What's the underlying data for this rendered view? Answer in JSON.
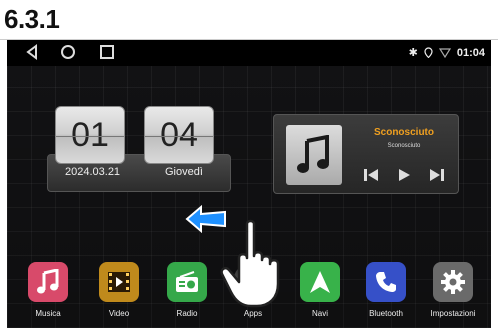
{
  "doc_label": "6.3.1",
  "status": {
    "time": "01:04"
  },
  "clock": {
    "hour": "01",
    "minute": "04",
    "date": "2024.03.21",
    "day": "Giovedì"
  },
  "music": {
    "title": "Sconosciuto",
    "artist": "Sconosciuto"
  },
  "apps": [
    {
      "label": "Musica",
      "icon": "music-icon",
      "color": "#d84a6a"
    },
    {
      "label": "Video",
      "icon": "film-icon",
      "color": "#c08a1c"
    },
    {
      "label": "Radio",
      "icon": "radio-icon",
      "color": "#35a84a"
    },
    {
      "label": "Apps",
      "icon": "apps-icon",
      "color": "#555555"
    },
    {
      "label": "Navi",
      "icon": "navigation-icon",
      "color": "#38b24a"
    },
    {
      "label": "Bluetooth",
      "icon": "phone-icon",
      "color": "#3650c8"
    },
    {
      "label": "Impostazioni",
      "icon": "gear-icon",
      "color": "#6a6a6a"
    }
  ],
  "colors": {
    "accent": "#f0a020",
    "swipe_arrow": "#1e90ff"
  }
}
